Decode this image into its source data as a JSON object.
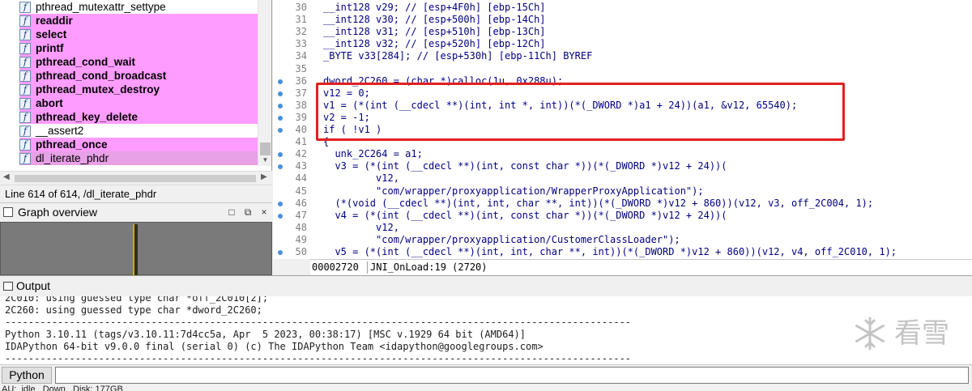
{
  "functions": {
    "items": [
      {
        "name": "pthread_mutexattr_settype",
        "style": "normal"
      },
      {
        "name": "readdir",
        "style": "lib"
      },
      {
        "name": "select",
        "style": "lib"
      },
      {
        "name": "printf",
        "style": "lib"
      },
      {
        "name": "pthread_cond_wait",
        "style": "lib"
      },
      {
        "name": "pthread_cond_broadcast",
        "style": "lib"
      },
      {
        "name": "pthread_mutex_destroy",
        "style": "lib"
      },
      {
        "name": "abort",
        "style": "lib"
      },
      {
        "name": "pthread_key_delete",
        "style": "lib"
      },
      {
        "name": "__assert2",
        "style": "normal"
      },
      {
        "name": "pthread_once",
        "style": "lib"
      },
      {
        "name": "dl_iterate_phdr",
        "style": "selected"
      }
    ],
    "icon_glyph": "f",
    "status": "Line 614 of 614, /dl_iterate_phdr"
  },
  "graph_overview": {
    "title": "Graph overview",
    "buttons": [
      "□",
      "⧉",
      "×"
    ]
  },
  "pseudocode": {
    "lines": [
      {
        "n": "30",
        "dot": false,
        "text": "__int128 v29; // [esp+4F0h] [ebp-15Ch]"
      },
      {
        "n": "31",
        "dot": false,
        "text": "__int128 v30; // [esp+500h] [ebp-14Ch]"
      },
      {
        "n": "32",
        "dot": false,
        "text": "__int128 v31; // [esp+510h] [ebp-13Ch]"
      },
      {
        "n": "33",
        "dot": false,
        "text": "__int128 v32; // [esp+520h] [ebp-12Ch]"
      },
      {
        "n": "34",
        "dot": false,
        "text": "_BYTE v33[284]; // [esp+530h] [ebp-11Ch] BYREF"
      },
      {
        "n": "35",
        "dot": false,
        "text": ""
      },
      {
        "n": "36",
        "dot": true,
        "text": "dword_2C260 = (char *)calloc(1u, 0x288u);"
      },
      {
        "n": "37",
        "dot": true,
        "text": "v12 = 0;"
      },
      {
        "n": "38",
        "dot": true,
        "text": "v1 = (*(int (__cdecl **)(int, int *, int))(*(_DWORD *)a1 + 24))(a1, &v12, 65540);"
      },
      {
        "n": "39",
        "dot": true,
        "text": "v2 = -1;"
      },
      {
        "n": "40",
        "dot": true,
        "text": "if ( !v1 )"
      },
      {
        "n": "41",
        "dot": false,
        "text": "{"
      },
      {
        "n": "42",
        "dot": true,
        "text": "  unk_2C264 = a1;"
      },
      {
        "n": "43",
        "dot": true,
        "text": "  v3 = (*(int (__cdecl **)(int, const char *))(*(_DWORD *)v12 + 24))("
      },
      {
        "n": "44",
        "dot": false,
        "text": "         v12,"
      },
      {
        "n": "45",
        "dot": false,
        "text": "         \"com/wrapper/proxyapplication/WrapperProxyApplication\");"
      },
      {
        "n": "46",
        "dot": true,
        "text": "  (*(void (__cdecl **)(int, int, char **, int))(*(_DWORD *)v12 + 860))(v12, v3, off_2C004, 1);"
      },
      {
        "n": "47",
        "dot": true,
        "text": "  v4 = (*(int (__cdecl **)(int, const char *))(*(_DWORD *)v12 + 24))("
      },
      {
        "n": "48",
        "dot": false,
        "text": "         v12,"
      },
      {
        "n": "49",
        "dot": false,
        "text": "         \"com/wrapper/proxyapplication/CustomerClassLoader\");"
      },
      {
        "n": "50",
        "dot": true,
        "text": "  v5 = (*(int (__cdecl **)(int, int, char **, int))(*(_DWORD *)v12 + 860))(v12, v4, off_2C010, 1);"
      }
    ],
    "status_addr": "00002720",
    "status_loc": "JNI_OnLoad:19 (2720)"
  },
  "output": {
    "title": "Output",
    "lines": [
      "2C010: using guessed type char *off_2C010[2];",
      "2C260: using guessed type char *dword_2C260;",
      "-----------------------------------------------------------------------------------------------------------",
      "Python 3.10.11 (tags/v3.10.11:7d4cc5a, Apr  5 2023, 00:38:17) [MSC v.1929 64 bit (AMD64)]",
      "IDAPython 64-bit v9.0.0 final (serial 0) (c) The IDAPython Team <idapython@googlegroups.com>",
      "-----------------------------------------------------------------------------------------------------------"
    ],
    "watermark_text": "看雪"
  },
  "python_bar": {
    "button_label": "Python",
    "input_value": ""
  },
  "bottom_status": "AU:  idle   Down   Disk: 177GB"
}
